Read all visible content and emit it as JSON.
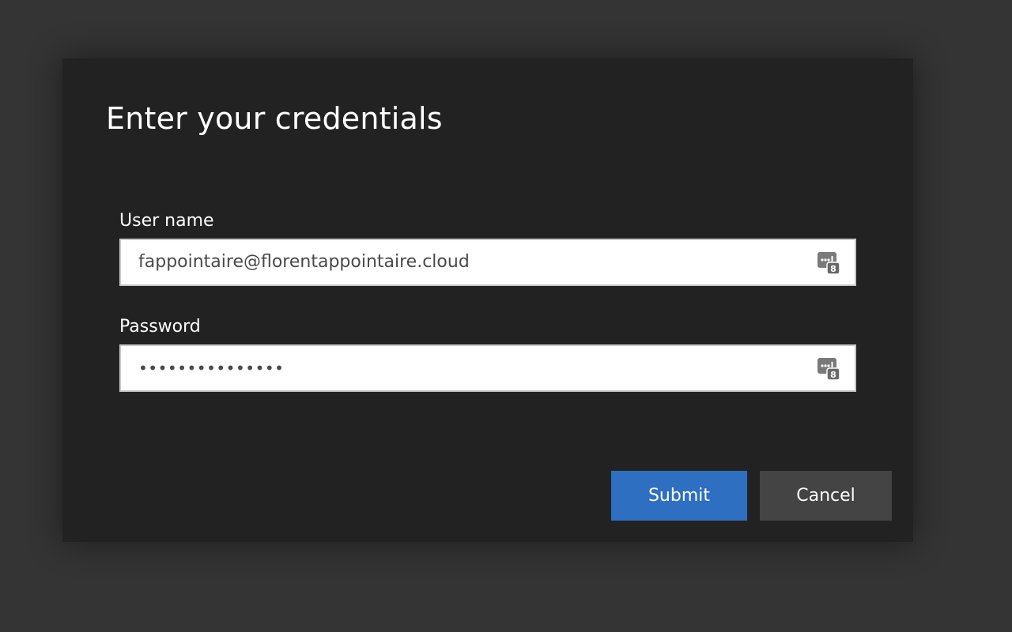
{
  "dialog": {
    "title": "Enter your credentials"
  },
  "username": {
    "label": "User name",
    "value": "fappointaire@florentappointaire.cloud",
    "icon": "password-manager-icon"
  },
  "password": {
    "label": "Password",
    "value": "•••••••••••••••",
    "icon": "password-manager-icon"
  },
  "buttons": {
    "submit_label": "Submit",
    "cancel_label": "Cancel"
  },
  "colors": {
    "backdrop": "#343434",
    "dialog": "#222222",
    "submit": "#2e6fc2",
    "cancel": "#444444"
  }
}
